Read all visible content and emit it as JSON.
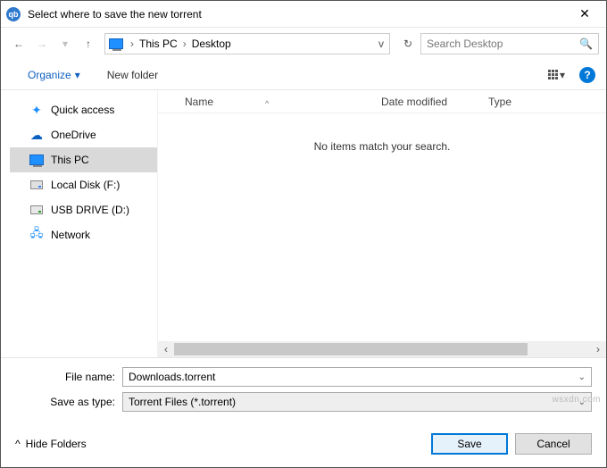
{
  "title": "Select where to save the new torrent",
  "app_icon_label": "qb",
  "nav": {
    "back": "←",
    "forward": "→",
    "up": "↑",
    "refresh": "↻"
  },
  "breadcrumb": {
    "sep1": "›",
    "item1": "This PC",
    "sep2": "›",
    "item2": "Desktop",
    "dd": "v"
  },
  "search": {
    "placeholder": "Search Desktop",
    "glyph": "🔍"
  },
  "toolbar": {
    "organize": "Organize",
    "organize_dd": "▾",
    "newfolder": "New folder",
    "view_dd": "▾",
    "help": "?"
  },
  "tree": {
    "quick": "Quick access",
    "onedrive": "OneDrive",
    "thispc": "This PC",
    "local": "Local Disk (F:)",
    "usb": "USB DRIVE (D:)",
    "network": "Network"
  },
  "columns": {
    "name": "Name",
    "sort": "^",
    "date": "Date modified",
    "type": "Type"
  },
  "empty_msg": "No items match your search.",
  "scroll": {
    "left": "‹",
    "right": "›"
  },
  "form": {
    "filename_label": "File name:",
    "filename_value": "Downloads.torrent",
    "saveas_label": "Save as type:",
    "saveas_value": "Torrent Files (*.torrent)",
    "dd": "⌄"
  },
  "footer": {
    "hide_caret": "^",
    "hide": "Hide Folders",
    "save": "Save",
    "cancel": "Cancel"
  },
  "watermark": "wsxdn.com"
}
